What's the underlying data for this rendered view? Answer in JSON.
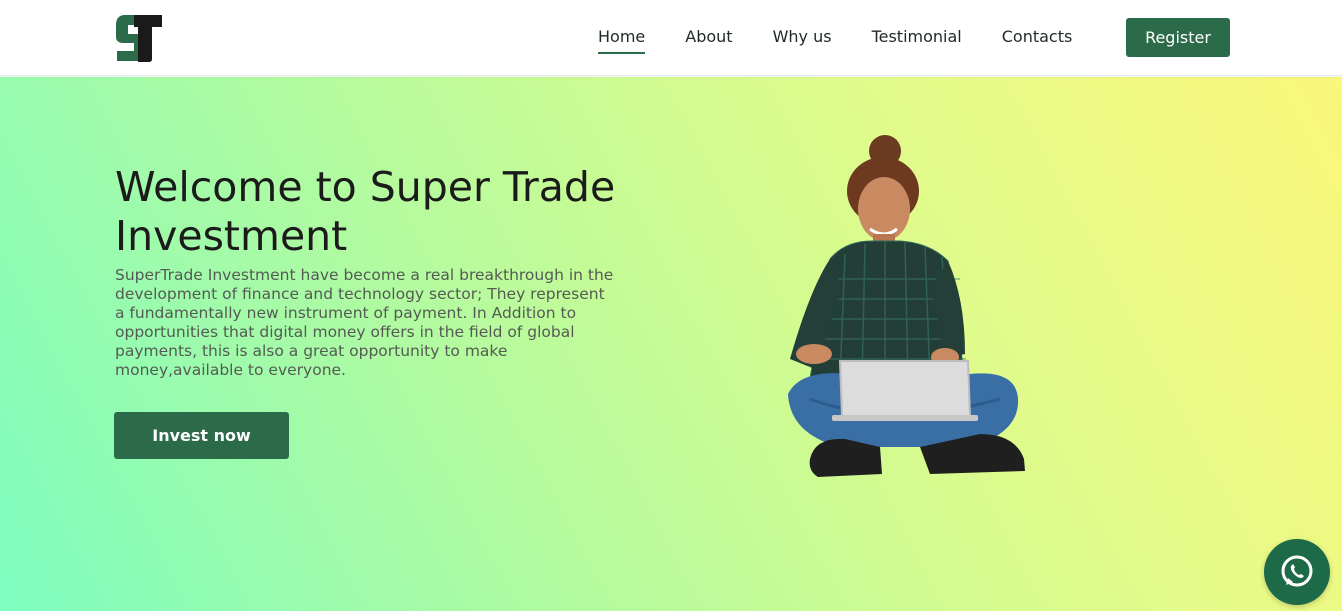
{
  "brand": {
    "logo_icon": "st-logo-icon",
    "accent": "#2b6b4a"
  },
  "nav": {
    "items": [
      {
        "label": "Home",
        "active": true
      },
      {
        "label": "About",
        "active": false
      },
      {
        "label": "Why us",
        "active": false
      },
      {
        "label": "Testimonial",
        "active": false
      },
      {
        "label": "Contacts",
        "active": false
      }
    ],
    "register_label": "Register"
  },
  "hero": {
    "title": "Welcome to Super Trade Investment",
    "description": "SuperTrade Investment have become a real breakthrough in the development of finance and technology sector; They represent a fundamentally new instrument of payment. In Addition to opportunities that digital money offers in the field of global payments, this is also a great opportunity to make money,available to everyone.",
    "cta_label": "Invest now",
    "illustration": "woman-with-laptop-illustration"
  },
  "floating": {
    "whatsapp_icon": "whatsapp-icon"
  }
}
